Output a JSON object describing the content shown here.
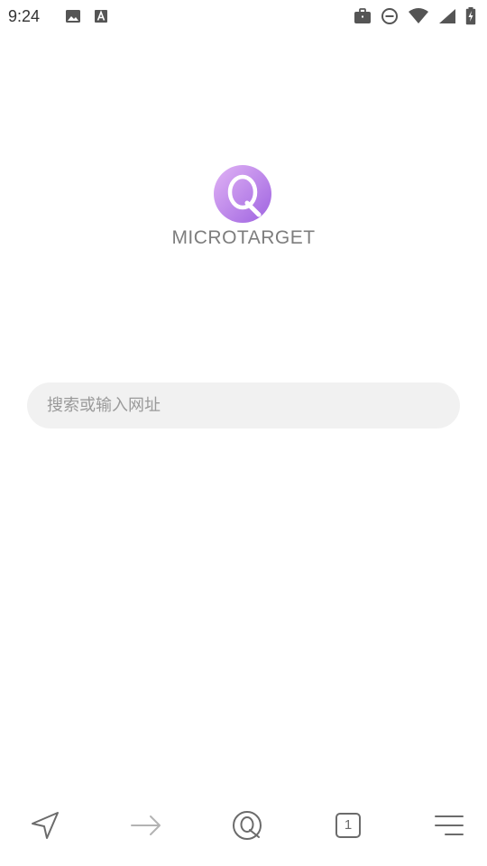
{
  "status_bar": {
    "time": "9:24",
    "left_icons": [
      "image-icon",
      "text-a-icon"
    ],
    "right_icons": [
      "briefcase-icon",
      "dnd-icon",
      "wifi-icon",
      "signal-icon",
      "battery-charging-icon"
    ]
  },
  "logo": {
    "text": "MICROTARGET",
    "letter": "Q",
    "gradient_colors": [
      "#e1b3f5",
      "#9e63e0"
    ]
  },
  "search": {
    "placeholder": "搜索或输入网址"
  },
  "toolbar": {
    "buttons": [
      "navigate-icon",
      "forward-icon",
      "home-icon",
      "tabs-button",
      "menu-icon"
    ],
    "tab_count": "1"
  },
  "colors": {
    "icon_gray": "#6b6b6b",
    "disabled_gray": "#b3b3b3",
    "search_bg": "#f1f1f1"
  }
}
